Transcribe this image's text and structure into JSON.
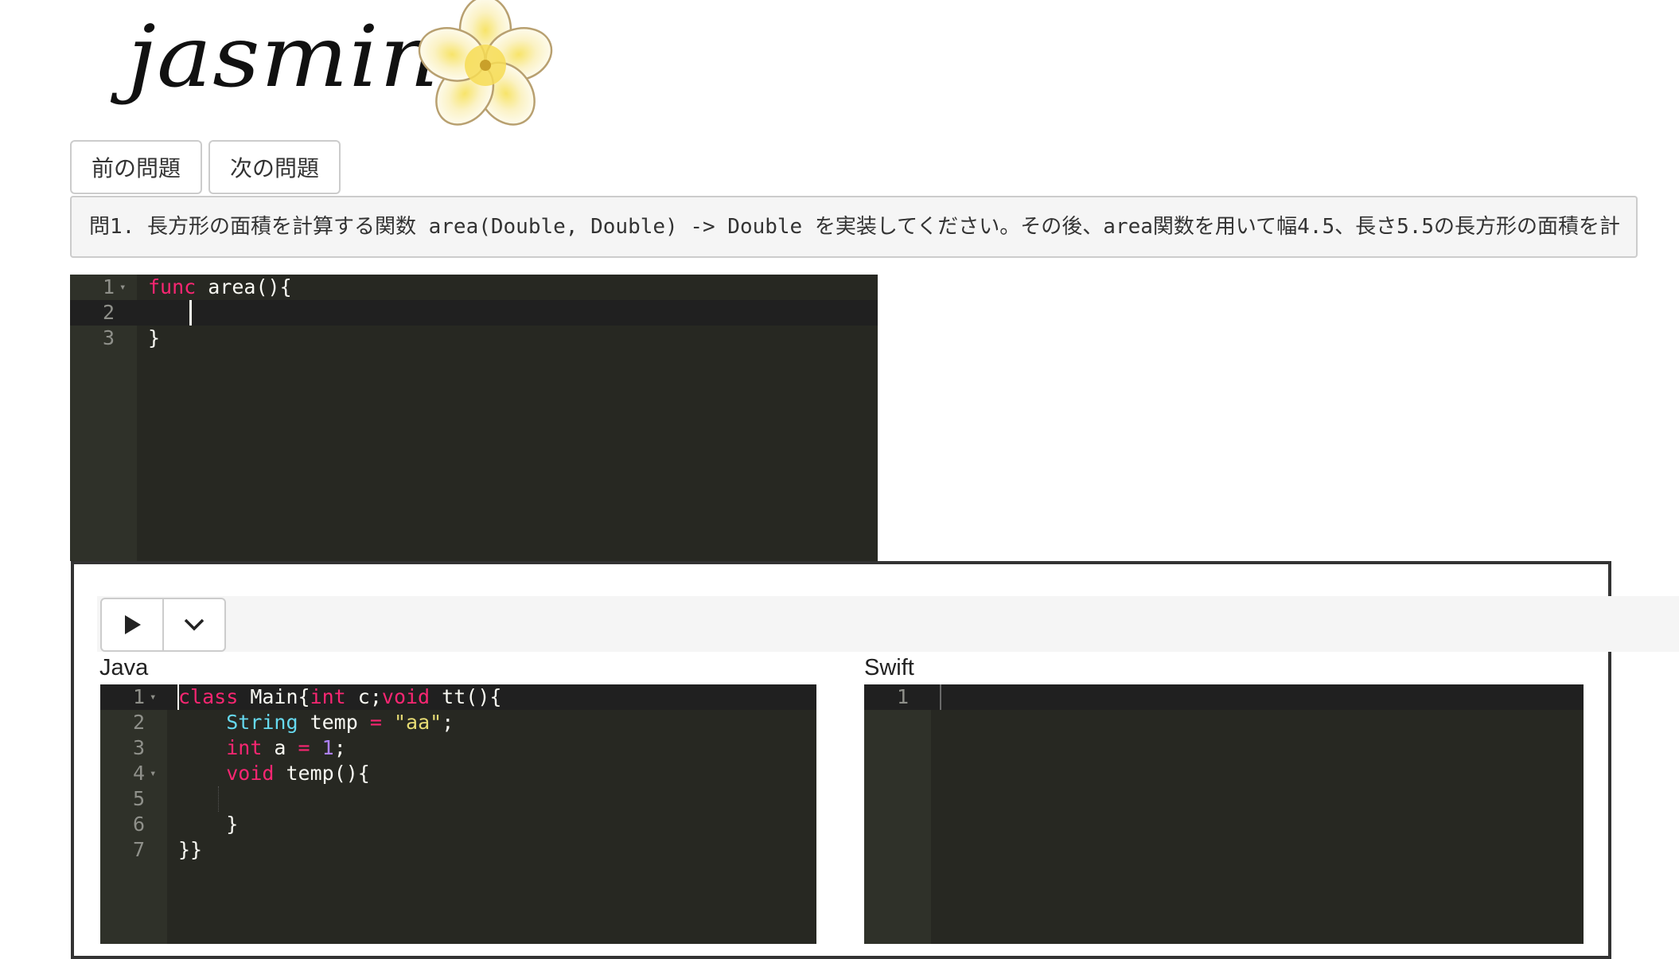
{
  "logo": {
    "text": "jasmin",
    "flower_icon": "flower-icon"
  },
  "nav": {
    "prev_label": "前の問題",
    "next_label": "次の問題"
  },
  "question": "問1. 長方形の面積を計算する関数 area(Double, Double) -> Double を実装してください。その後、area関数を用いて幅4.5、長さ5.5の長方形の面積を計",
  "main_editor": {
    "language": "Swift",
    "line_numbers": [
      "1",
      "2",
      "3"
    ]
  },
  "toolbar": {
    "run_icon": "play-icon",
    "dropdown_icon": "chevron-down-icon"
  },
  "java_panel": {
    "label": "Java",
    "line_numbers": [
      "1",
      "2",
      "3",
      "4",
      "5",
      "6",
      "7"
    ]
  },
  "swift_panel": {
    "label": "Swift",
    "line_numbers": [
      "1"
    ]
  },
  "colors": {
    "editor_bg": "#272822",
    "gutter_bg": "#2f3129",
    "keyword": "#f92672",
    "type": "#66d9ef",
    "string": "#e6db74",
    "number": "#ae81ff",
    "text": "#f8f8f2"
  }
}
